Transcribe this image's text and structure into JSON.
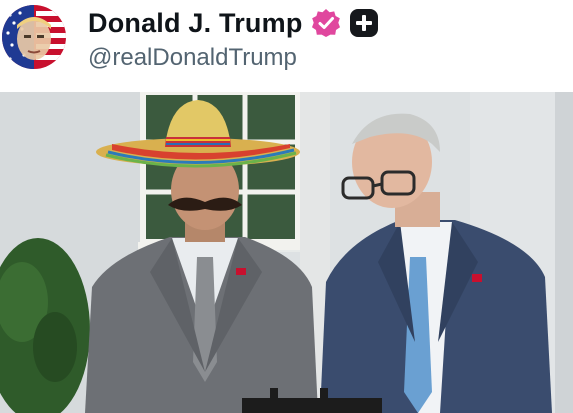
{
  "post": {
    "display_name": "Donald J. Trump",
    "handle": "@realDonaldTrump",
    "badge_icon": "verified-badge-icon",
    "badge_color": "#e0479e",
    "plus_icon": "plus-square-icon"
  },
  "media": {
    "description_icon": "photo"
  }
}
